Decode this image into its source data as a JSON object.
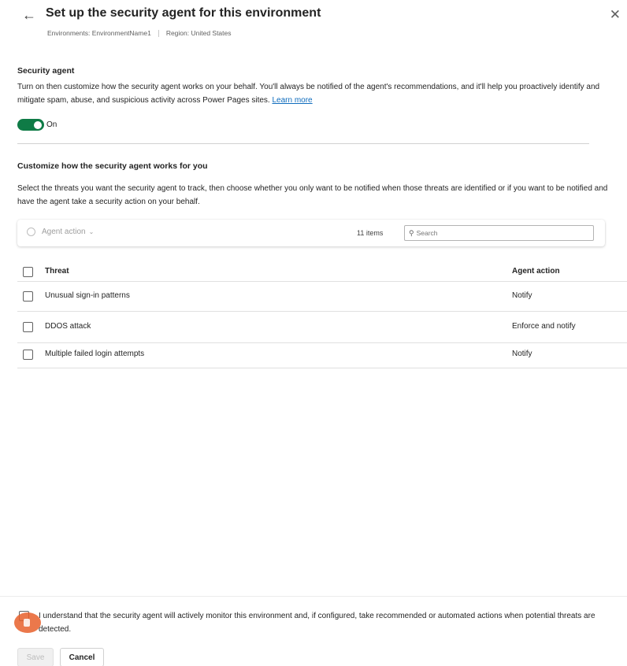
{
  "header": {
    "title": "Set up the security agent for this environment",
    "environment": "Environments: EnvironmentName1",
    "region": "Region: United States",
    "back_icon": "arrow-left-icon",
    "close_icon": "close-icon"
  },
  "security_agent": {
    "heading": "Security agent",
    "description": "Turn on then customize how the security agent works on your behalf. You'll always be notified of the agent's recommendations, and it'll help you proactively identify and mitigate spam, abuse, and suspicious activity across Power Pages sites.",
    "learn_more": "Learn more",
    "toggle_label": "On",
    "toggle_on": true
  },
  "customize": {
    "heading": "Customize how the security agent works for you",
    "description": "Select the threats you want the security agent to track, then choose whether you only want to be notified when those threats are identified or if you want to be notified and have the agent take a security action on your behalf."
  },
  "toolbar": {
    "agent_action_label": "Agent action",
    "items_count": "11 items",
    "search_placeholder": "Search"
  },
  "table": {
    "columns": [
      "Threat",
      "Agent action"
    ],
    "rows": [
      {
        "threat": "Unusual sign-in patterns",
        "action": "Notify"
      },
      {
        "threat": "DDOS attack",
        "action": "Enforce and notify"
      },
      {
        "threat": "Multiple failed login attempts",
        "action": "Notify"
      }
    ]
  },
  "consent": {
    "text": "I understand that the security agent will actively monitor this environment and, if configured, take recommended or automated actions when potential threats are detected."
  },
  "buttons": {
    "save": "Save",
    "cancel": "Cancel"
  },
  "colors": {
    "toggle": "#0f7b46",
    "link": "#0f6cbd",
    "cursor": "#e8602c"
  }
}
